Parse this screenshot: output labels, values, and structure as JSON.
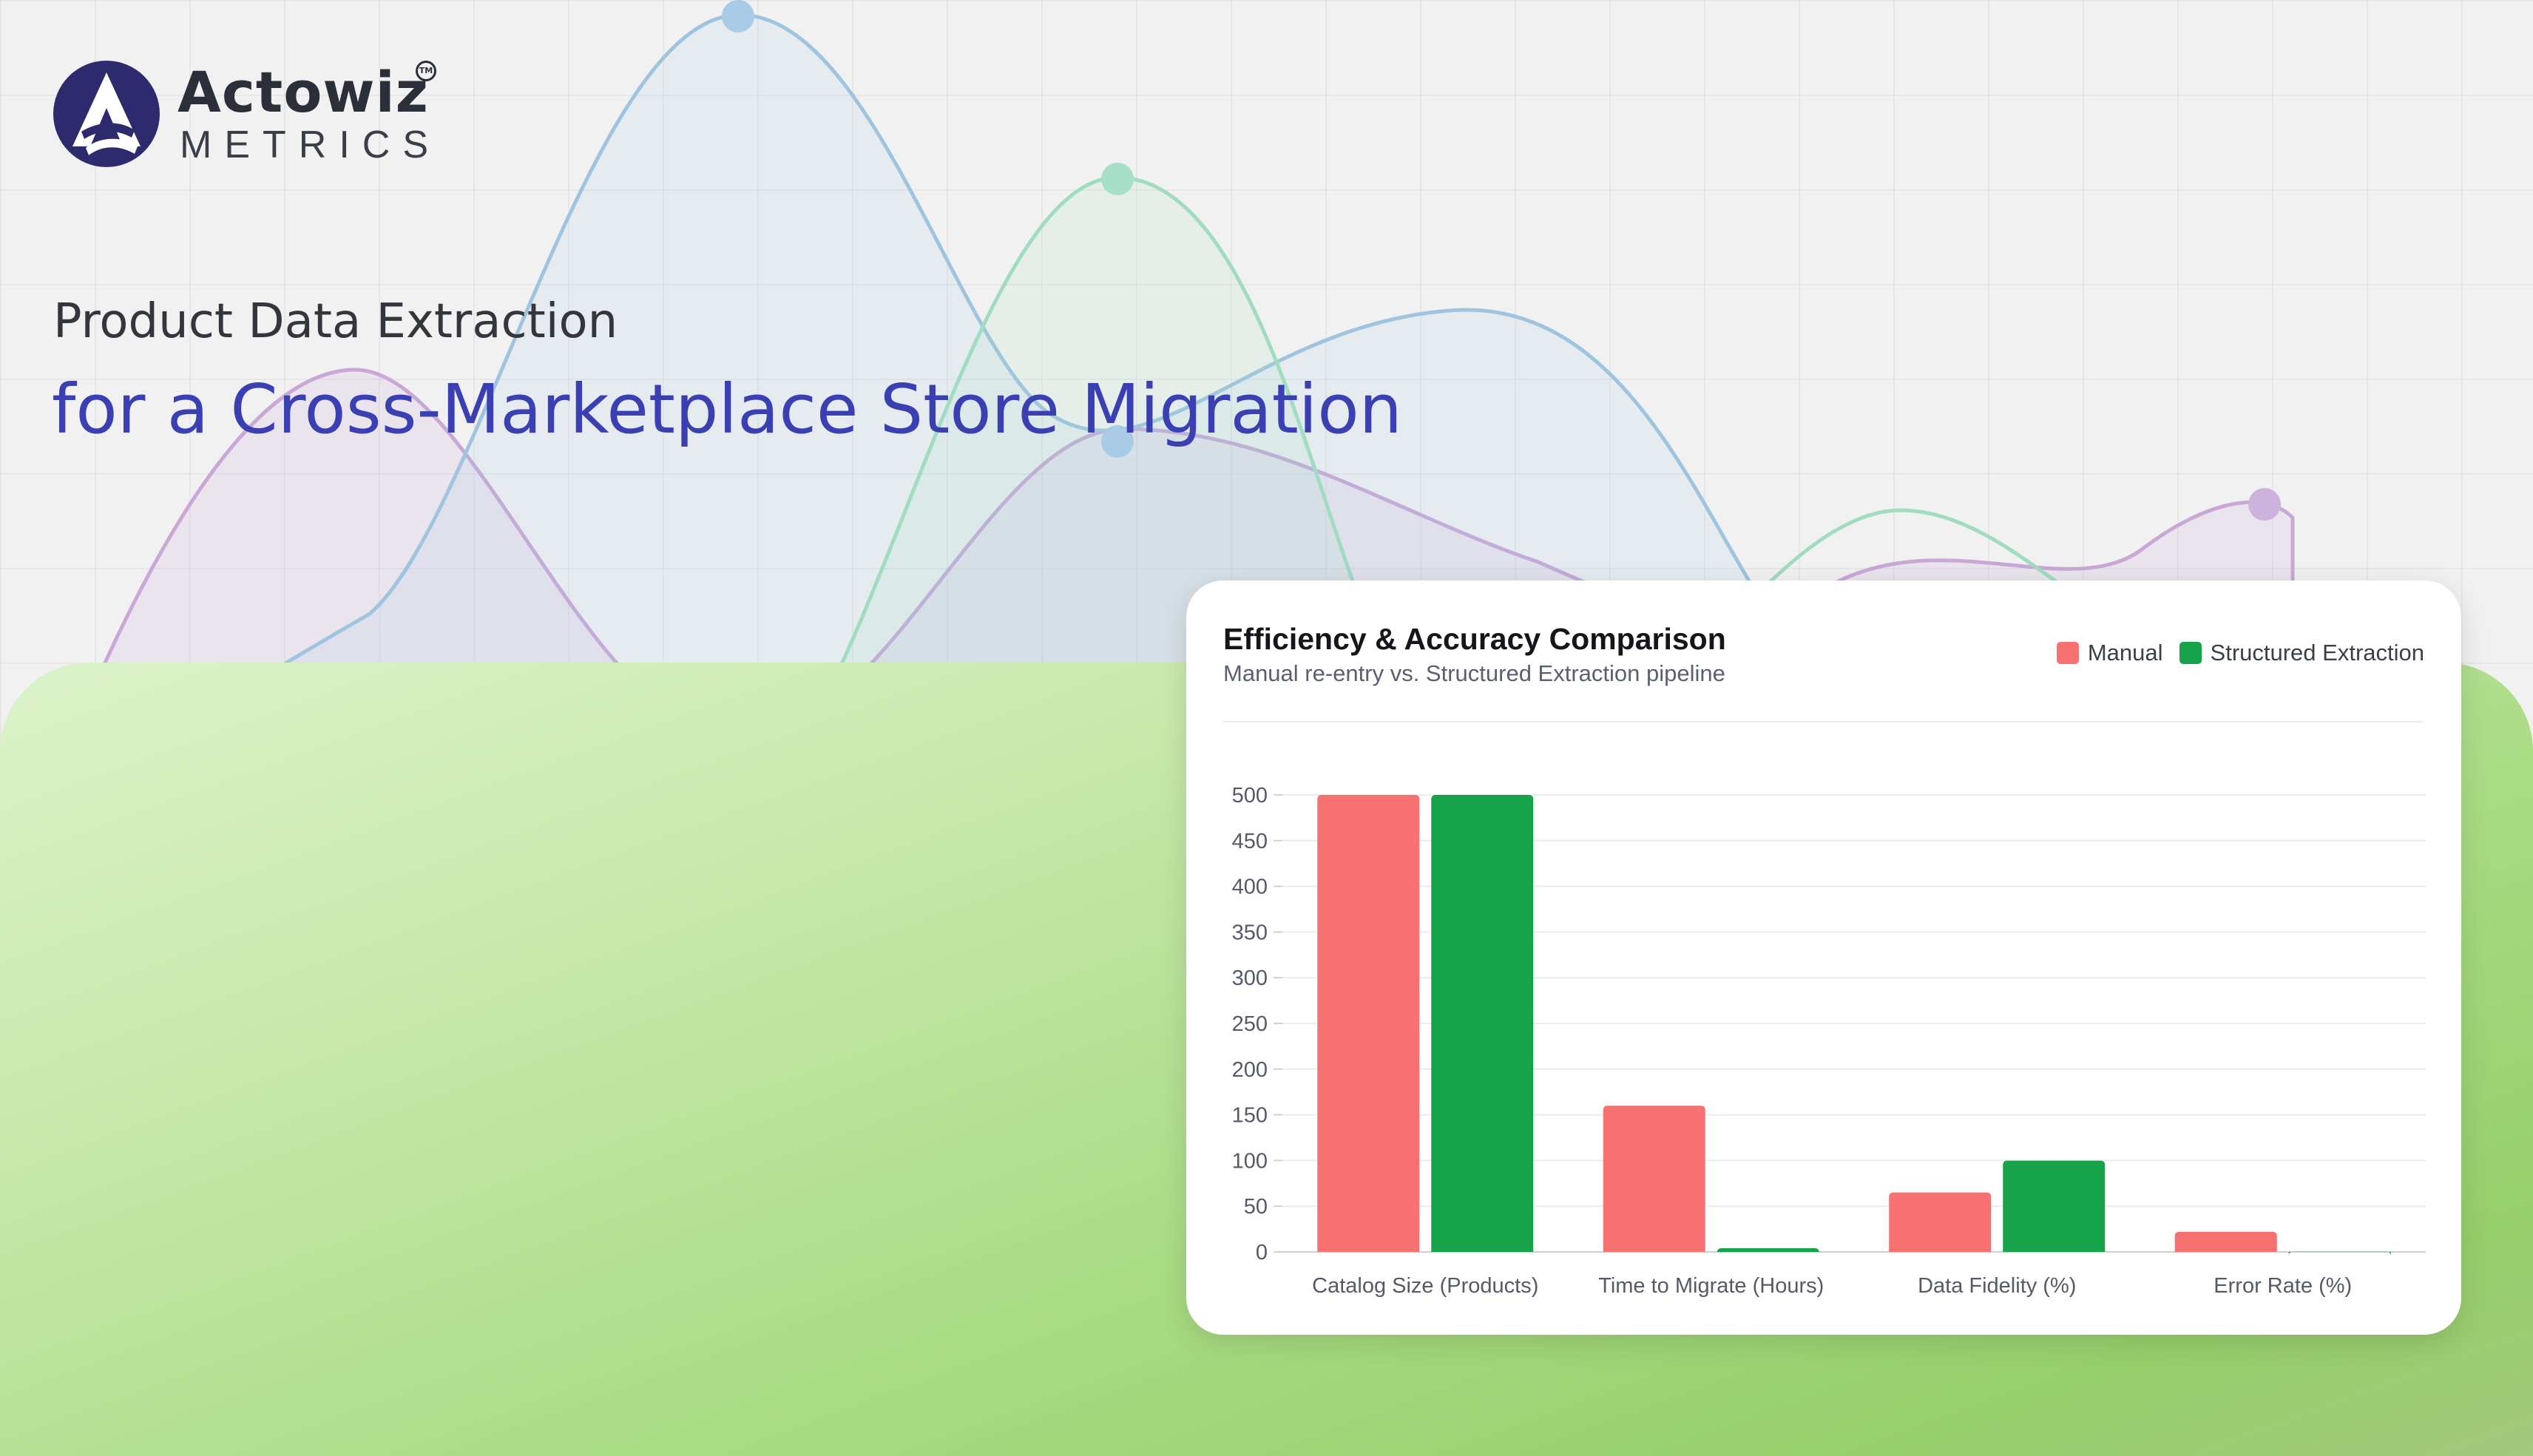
{
  "brand": {
    "name": "Actowiz",
    "sub": "METRICS",
    "tm": "TM",
    "primary_color": "#2d2a6e"
  },
  "headline": {
    "line1": "Product Data Extraction",
    "line2": "for a Cross-Marketplace Store Migration",
    "line2_color": "#3a3fb3"
  },
  "colors": {
    "manual": "#f87171",
    "structured": "#16a34a",
    "wave_blue": "#9fc4e0",
    "wave_green": "#9fdcc0",
    "wave_purple": "#c9a8d8"
  },
  "chart_data": {
    "type": "bar",
    "title": "Efficiency & Accuracy Comparison",
    "subtitle": "Manual re-entry vs. Structured Extraction pipeline",
    "categories": [
      "Catalog Size (Products)",
      "Time to Migrate (Hours)",
      "Data Fidelity (%)",
      "Error Rate (%)"
    ],
    "series": [
      {
        "name": "Manual",
        "values": [
          500,
          160,
          65,
          22
        ]
      },
      {
        "name": "Structured Extraction",
        "values": [
          500,
          4,
          99.8,
          0.2
        ]
      }
    ],
    "ylim": [
      0,
      500
    ],
    "yticks": [
      0,
      50,
      100,
      150,
      200,
      250,
      300,
      350,
      400,
      450,
      500
    ],
    "grid": true,
    "legend_position": "top-right"
  }
}
